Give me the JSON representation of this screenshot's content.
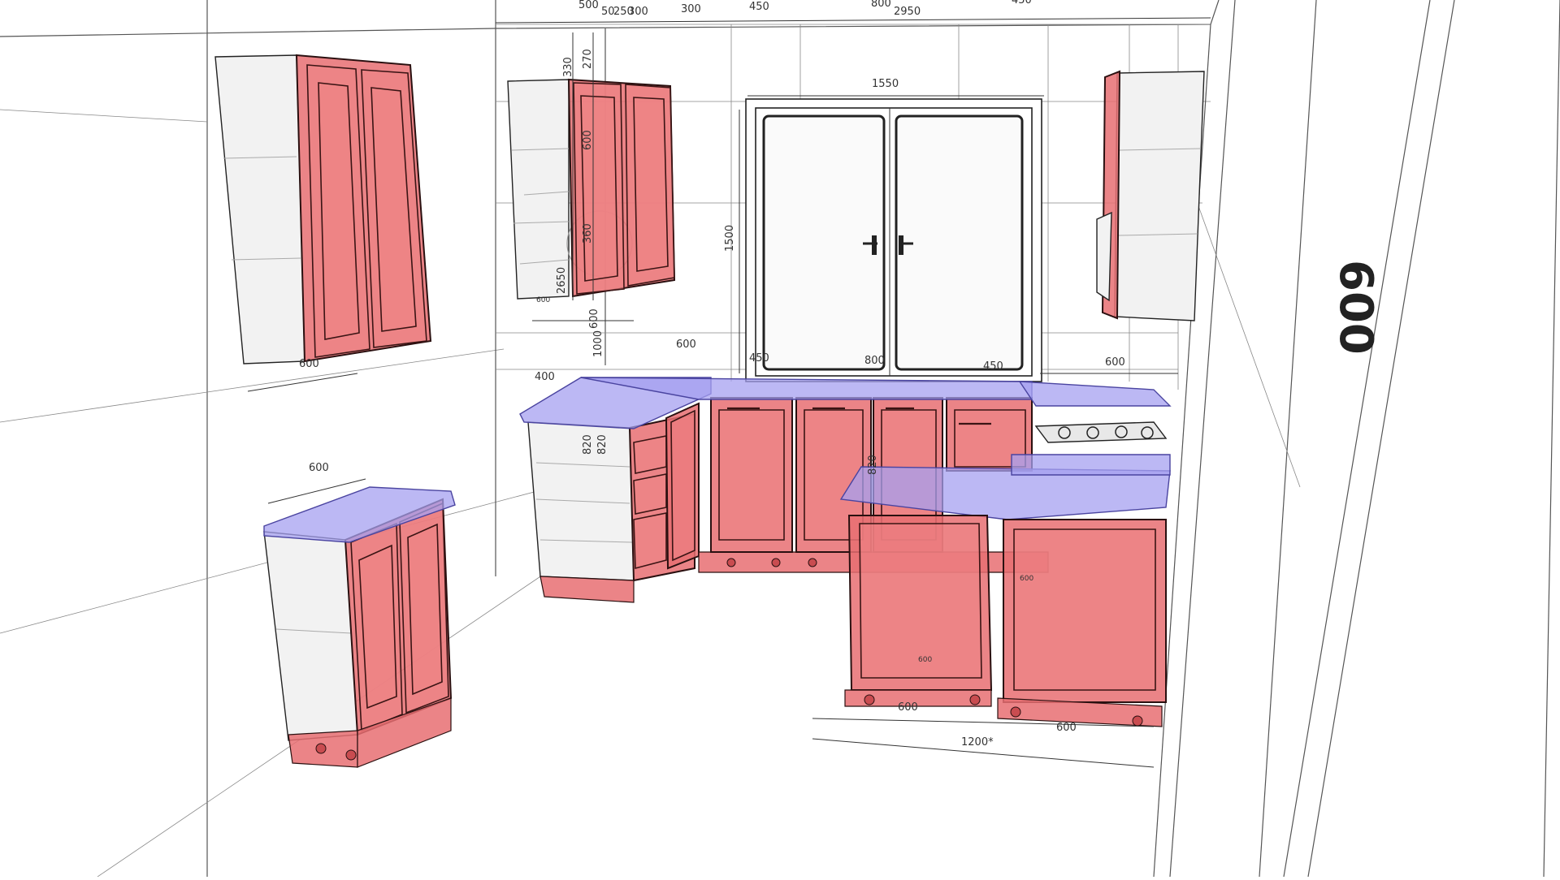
{
  "dimensions": {
    "top_labels": [
      "500",
      "50",
      "250",
      "300",
      "300",
      "450",
      "800",
      "2950",
      "450"
    ],
    "wall_upper_left_width": "600",
    "upper_corner_heights": [
      "330",
      "270",
      "600",
      "360",
      "2650"
    ],
    "window_width": "1550",
    "window_height": "1500",
    "gap_labels": [
      "600",
      "1000",
      "400",
      "600"
    ],
    "window_segments": [
      "450",
      "800",
      "450"
    ],
    "right_run_depth": "600",
    "base_heights": [
      "820",
      "820",
      "820"
    ],
    "base_left_width": "600",
    "island_widths": [
      "600",
      "600"
    ],
    "island_total": "1200*",
    "side_wall_height": "600",
    "small_tags": [
      "600",
      "600",
      "600"
    ]
  },
  "colors": {
    "fronts": "#e86f72",
    "countertops": "#a6a0f0",
    "carcass": "#f2f2f2"
  }
}
